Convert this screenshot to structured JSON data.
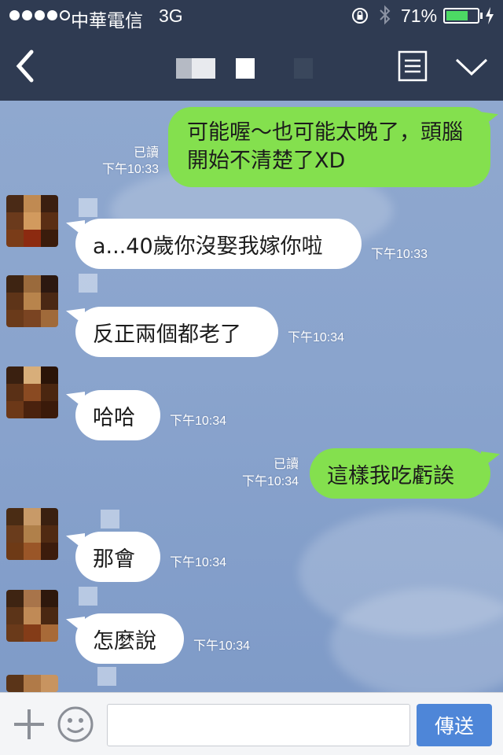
{
  "status_bar": {
    "carrier": "中華電信",
    "network": "3G",
    "battery_percent": "71%",
    "battery_level": 0.71,
    "icons": [
      "signal-dots",
      "orientation-lock-icon",
      "bluetooth-icon",
      "battery-icon",
      "charging-bolt-icon"
    ]
  },
  "nav": {
    "back_icon": "chevron-left-icon",
    "title_obscured": true,
    "menu_icon": "menu-icon",
    "collapse_icon": "chevron-down-icon"
  },
  "messages": [
    {
      "side": "out",
      "text": "可能喔～也可能太晚了，頭腦開始不清楚了XD",
      "read": "已讀",
      "time": "下午10:33"
    },
    {
      "side": "in",
      "text": "a...40歲你沒娶我嫁你啦",
      "time": "下午10:33"
    },
    {
      "side": "in",
      "text": "反正兩個都老了",
      "time": "下午10:34"
    },
    {
      "side": "in",
      "text": "哈哈",
      "time": "下午10:34"
    },
    {
      "side": "out",
      "text": "這樣我吃虧誒",
      "read": "已讀",
      "time": "下午10:34"
    },
    {
      "side": "in",
      "text": "那會",
      "time": "下午10:34"
    },
    {
      "side": "in",
      "text": "怎麼說",
      "time": "下午10:34"
    }
  ],
  "input_bar": {
    "plus_icon": "plus-icon",
    "emoji_icon": "smiley-icon",
    "placeholder": "",
    "send_label": "傳送"
  },
  "colors": {
    "header": "#2f3b52",
    "outgoing_bubble": "#84e04e",
    "incoming_bubble": "#ffffff",
    "chat_background": "#8aa4cd",
    "send_button": "#4e86d8"
  }
}
